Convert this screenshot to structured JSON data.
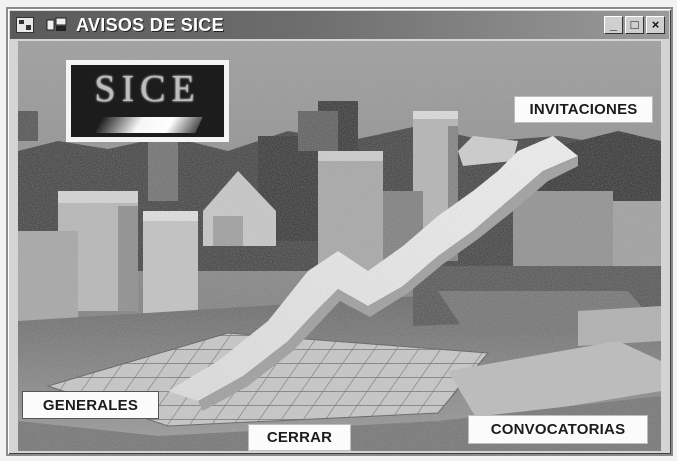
{
  "window": {
    "title": "AVISOS DE SICE",
    "controls": {
      "minimize": "_",
      "maximize": "□",
      "close": "×"
    }
  },
  "logo": {
    "text": "SICE"
  },
  "buttons": {
    "invitaciones": "INVITACIONES",
    "generales": "GENERALES",
    "cerrar": "CERRAR",
    "convocatorias": "CONVOCATORIAS"
  },
  "icons": {
    "titlebar_app": "app-window-icon",
    "titlebar_menu": "app-menu-icon",
    "background": "city-graph-illustration"
  }
}
